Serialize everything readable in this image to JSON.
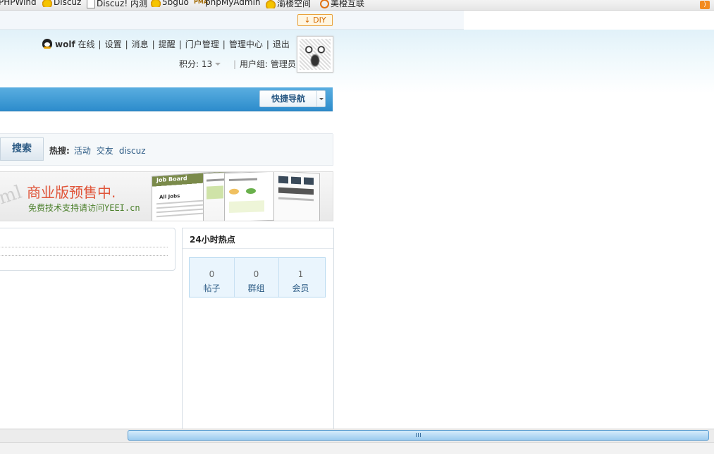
{
  "bookmarks": [
    {
      "label": "PHPWind",
      "icon": "none"
    },
    {
      "label": "Discuz",
      "icon": "star-icon"
    },
    {
      "label": "Discuz! 内测",
      "icon": "page-icon"
    },
    {
      "label": "5bguo",
      "icon": "star-icon"
    },
    {
      "label": "phpMyAdmin",
      "icon": "pma-icon"
    },
    {
      "label": "渝楼空间",
      "icon": "star-icon"
    },
    {
      "label": "美橙互联",
      "icon": "circle-icon"
    }
  ],
  "diy": {
    "label": "DIY",
    "arrow": "↓"
  },
  "user": {
    "name": "wolf",
    "status": "在线",
    "links": [
      "设置",
      "消息",
      "提醒",
      "门户管理",
      "管理中心",
      "退出"
    ],
    "points_label": "积分: 13",
    "group_label": "用户组: 管理员"
  },
  "nav": {
    "quicknav_label": "快捷导航"
  },
  "search": {
    "button_label": "搜索",
    "hot_label": "热搜:",
    "hot_terms": [
      "活动",
      "交友",
      "discuz"
    ]
  },
  "banner": {
    "headline": "商业版预售中.",
    "subline": "免费技术支持请访问YEEI.cn",
    "shot_title": "Job Board",
    "shot_subtitle": "All Jobs"
  },
  "hot24": {
    "title": "24小时热点",
    "stats": [
      {
        "value": "0",
        "label": "帖子"
      },
      {
        "value": "0",
        "label": "群组"
      },
      {
        "value": "1",
        "label": "会员"
      }
    ]
  },
  "colors": {
    "nav_blue": "#2d8ccc",
    "link": "#2b5a84",
    "diy_orange": "#d46a00"
  }
}
